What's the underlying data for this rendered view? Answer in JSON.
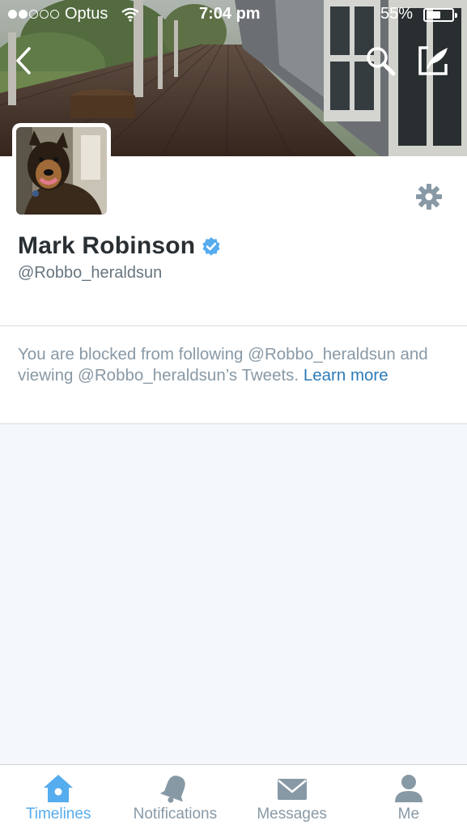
{
  "status_bar": {
    "carrier": "Optus",
    "time": "7:04 pm",
    "battery_percent": "55%",
    "battery_level": 0.55,
    "signal_bars_filled": 2,
    "signal_bars_total": 5
  },
  "nav": {
    "back_icon": "chevron-left-icon",
    "search_icon": "search-icon",
    "compose_icon": "compose-tweet-icon"
  },
  "profile": {
    "display_name": "Mark Robinson",
    "handle": "@Robbo_heraldsun",
    "verified": true,
    "settings_icon": "gear-icon"
  },
  "notice": {
    "text": "You are blocked from following @Robbo_heraldsun and viewing @Robbo_heraldsun’s Tweets.",
    "link_text": "Learn more"
  },
  "tabs": [
    {
      "label": "Timelines",
      "icon": "home-icon",
      "active": true
    },
    {
      "label": "Notifications",
      "icon": "bell-icon",
      "active": false
    },
    {
      "label": "Messages",
      "icon": "envelope-icon",
      "active": false
    },
    {
      "label": "Me",
      "icon": "person-icon",
      "active": false
    }
  ],
  "colors": {
    "accent": "#55acee",
    "link": "#2b7bb9",
    "muted": "#8899a6",
    "verified": "#55acee",
    "background": "#f5f8fa"
  }
}
